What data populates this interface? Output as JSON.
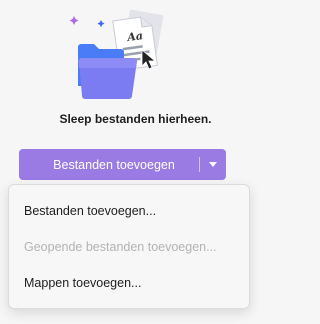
{
  "drop_zone": {
    "icon": "folder-documents-illustration",
    "text": "Sleep bestanden hierheen."
  },
  "add_button": {
    "label": "Bestanden toevoegen",
    "dropdown_icon": "caret-down-icon",
    "color": "#9a7ae3"
  },
  "menu": {
    "items": [
      {
        "label": "Bestanden toevoegen...",
        "enabled": true
      },
      {
        "label": "Geopende bestanden toevoegen...",
        "enabled": false
      },
      {
        "label": "Mappen toevoegen...",
        "enabled": true
      }
    ]
  }
}
